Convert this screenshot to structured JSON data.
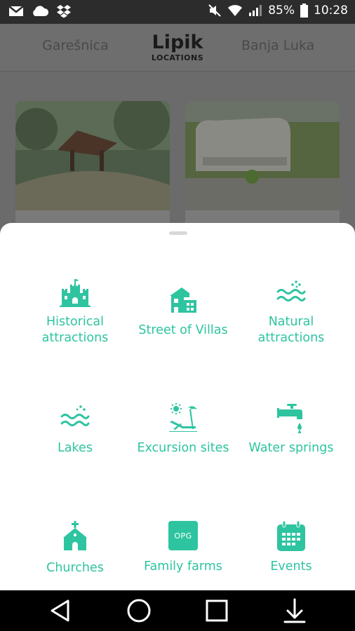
{
  "status_bar": {
    "battery_percent": "85%",
    "time": "10:28"
  },
  "location_header": {
    "prev": "Garešnica",
    "current": "Lipik",
    "subtitle": "LOCATIONS",
    "next": "Banja Luka"
  },
  "categories": [
    {
      "label": "Historical\nattractions",
      "icon": "castle-icon"
    },
    {
      "label": "Street of Villas",
      "icon": "villa-icon"
    },
    {
      "label": "Natural\nattractions",
      "icon": "waves-icon"
    },
    {
      "label": "Lakes",
      "icon": "lake-icon"
    },
    {
      "label": "Excursion sites",
      "icon": "beach-chair-icon"
    },
    {
      "label": "Water springs",
      "icon": "faucet-icon"
    },
    {
      "label": "Churches",
      "icon": "church-icon"
    },
    {
      "label": "Family farms",
      "icon": "opg-icon",
      "badge": "OPG"
    },
    {
      "label": "Events",
      "icon": "calendar-icon"
    }
  ],
  "colors": {
    "accent": "#2ec4a0",
    "scrim": "#6b6b6b"
  },
  "nav_bar": {
    "items": [
      "back-icon",
      "home-icon",
      "recents-icon",
      "notification-pull-icon"
    ]
  }
}
